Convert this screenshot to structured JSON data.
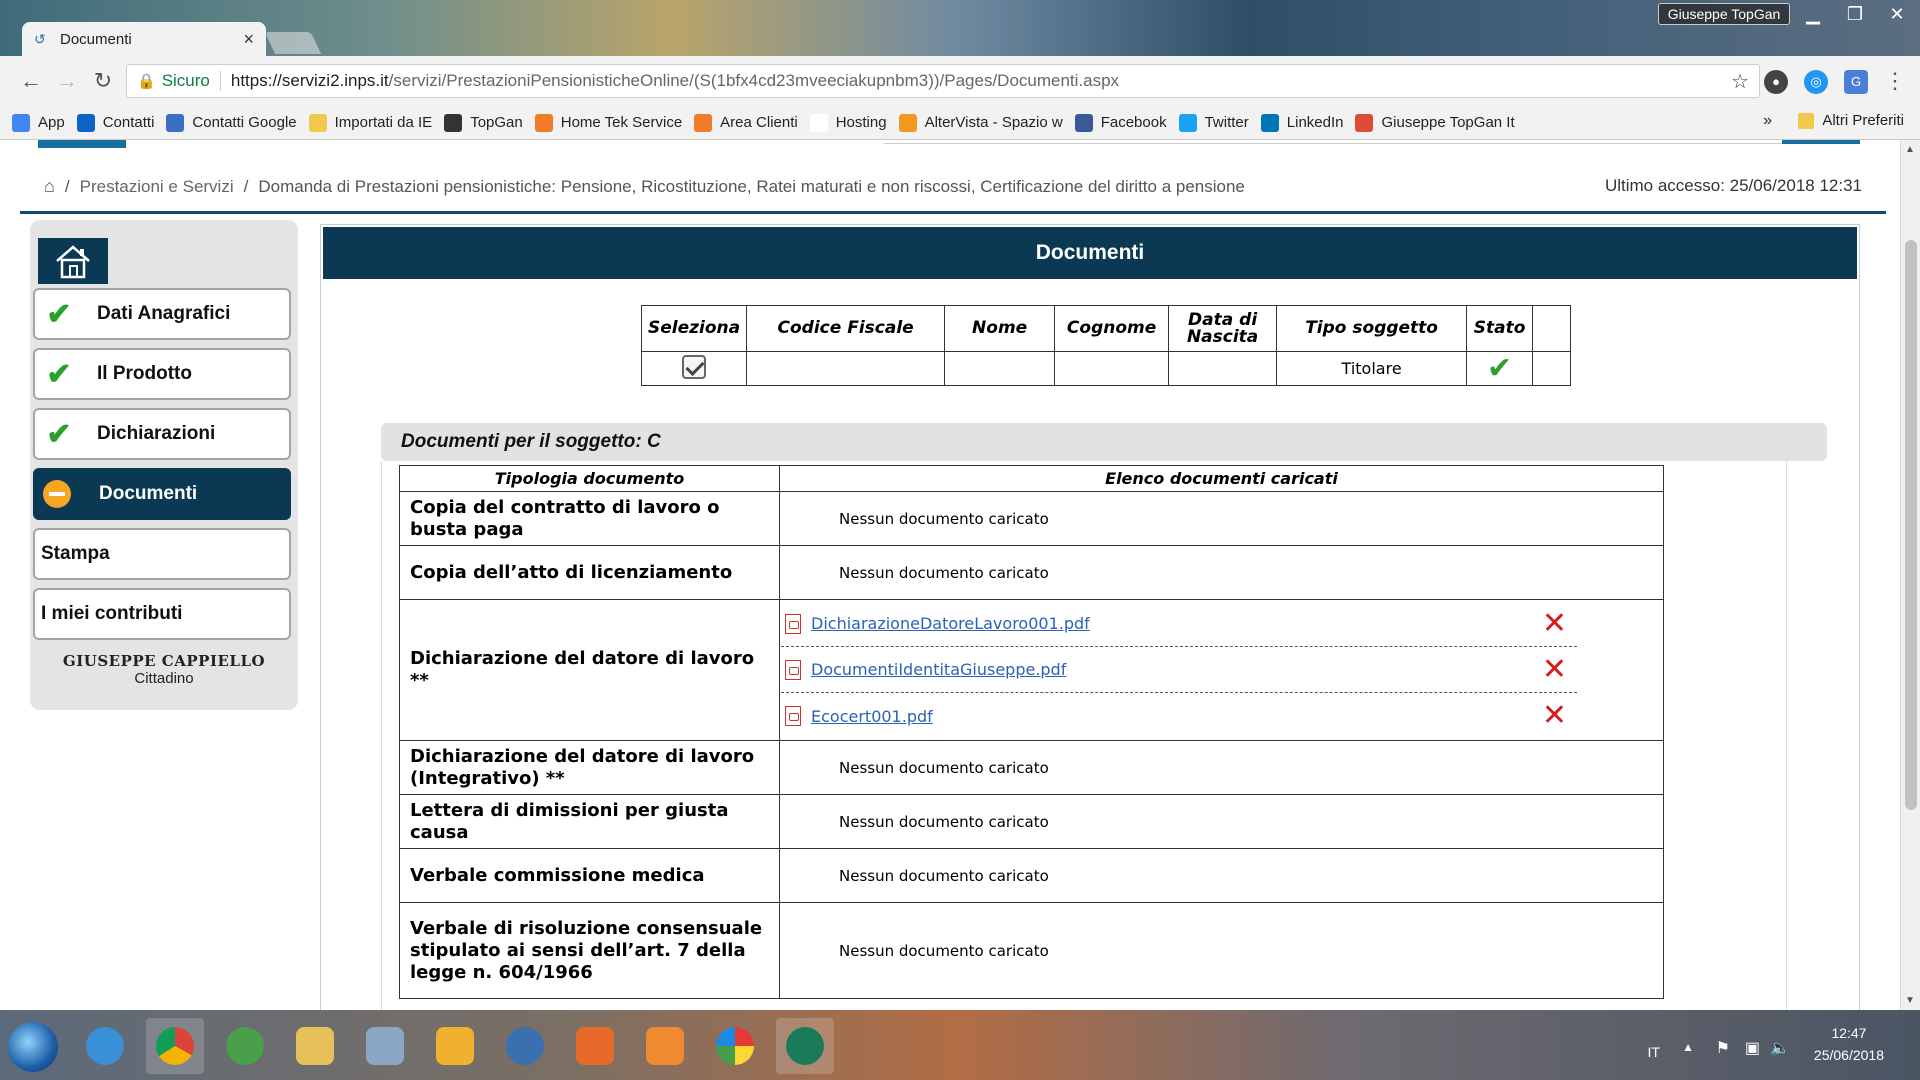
{
  "browser": {
    "tab_title": "Documenti",
    "tab_close": "×",
    "profile_name": "Giuseppe TopGan",
    "url_secure_label": "Sicuro",
    "url_main": "https://servizi2.inps.it",
    "url_rest": "/servizi/PrestazioniPensionisticheOnline/(S(1bfx4cd23mveeciakupnbm3))/Pages/Documenti.aspx",
    "bookmarks": [
      {
        "label": "App",
        "color": "#4285f4"
      },
      {
        "label": "Contatti",
        "color": "#0a64c9"
      },
      {
        "label": "Contatti Google",
        "color": "#3b6fc4"
      },
      {
        "label": "Importati da IE",
        "color": "#f2c94c"
      },
      {
        "label": "TopGan",
        "color": "#333333"
      },
      {
        "label": "Home Tek Service",
        "color": "#f07c2a"
      },
      {
        "label": "Area Clienti",
        "color": "#f07c2a"
      },
      {
        "label": "Hosting",
        "color": "#ffffff"
      },
      {
        "label": "AlterVista - Spazio w",
        "color": "#f29a1f"
      },
      {
        "label": "Facebook",
        "color": "#3b5998"
      },
      {
        "label": "Twitter",
        "color": "#1da1f2"
      },
      {
        "label": "LinkedIn",
        "color": "#0077b5"
      },
      {
        "label": "Giuseppe TopGan It",
        "color": "#dd4b39"
      }
    ],
    "bookmarks_more": "»",
    "bookmarks_other": "Altri Preferiti"
  },
  "page": {
    "breadcrumb": [
      "Prestazioni e Servizi",
      "Domanda di Prestazioni pensionistiche: Pensione, Ricostituzione, Ratei maturati e non riscossi, Certificazione del diritto a pensione"
    ],
    "last_access": "Ultimo accesso: 25/06/2018 12:31",
    "sidebar": {
      "items": [
        {
          "label": "Dati Anagrafici",
          "state": "done"
        },
        {
          "label": "Il Prodotto",
          "state": "done"
        },
        {
          "label": "Dichiarazioni",
          "state": "done"
        },
        {
          "label": "Documenti",
          "state": "active"
        },
        {
          "label": "Stampa",
          "state": "none"
        },
        {
          "label": "I miei contributi",
          "state": "none"
        }
      ],
      "user_name": "GIUSEPPE CAPPIELLO",
      "user_role": "Cittadino"
    },
    "header_title": "Documenti",
    "subject_table": {
      "headers": [
        "Seleziona",
        "Codice Fiscale",
        "Nome",
        "Cognome",
        "Data di Nascita",
        "Tipo soggetto",
        "Stato",
        ""
      ],
      "row": {
        "tipo": "Titolare"
      }
    },
    "docs_title": "Documenti per il soggetto: C",
    "docs_table": {
      "headers": [
        "Tipologia documento",
        "Elenco documenti caricati"
      ],
      "empty_label": "Nessun documento caricato",
      "rows": [
        {
          "type": "Copia del contratto di lavoro o busta paga",
          "files": []
        },
        {
          "type": "Copia dell’atto di licenziamento",
          "files": []
        },
        {
          "type": "Dichiarazione del datore di lavoro **",
          "files": [
            "DichiarazioneDatoreLavoro001.pdf",
            "DocumentiIdentitaGiuseppe.pdf",
            "Ecocert001.pdf"
          ]
        },
        {
          "type": "Dichiarazione del datore di lavoro (Integrativo) **",
          "files": []
        },
        {
          "type": "Lettera di dimissioni per giusta causa",
          "files": []
        },
        {
          "type": "Verbale commissione medica",
          "files": []
        },
        {
          "type": "Verbale di risoluzione consensuale stipulato ai sensi dell’art. 7 della legge n. 604/1966",
          "files": []
        }
      ]
    }
  },
  "taskbar": {
    "lang": "IT",
    "time": "12:47",
    "date": "25/06/2018"
  }
}
